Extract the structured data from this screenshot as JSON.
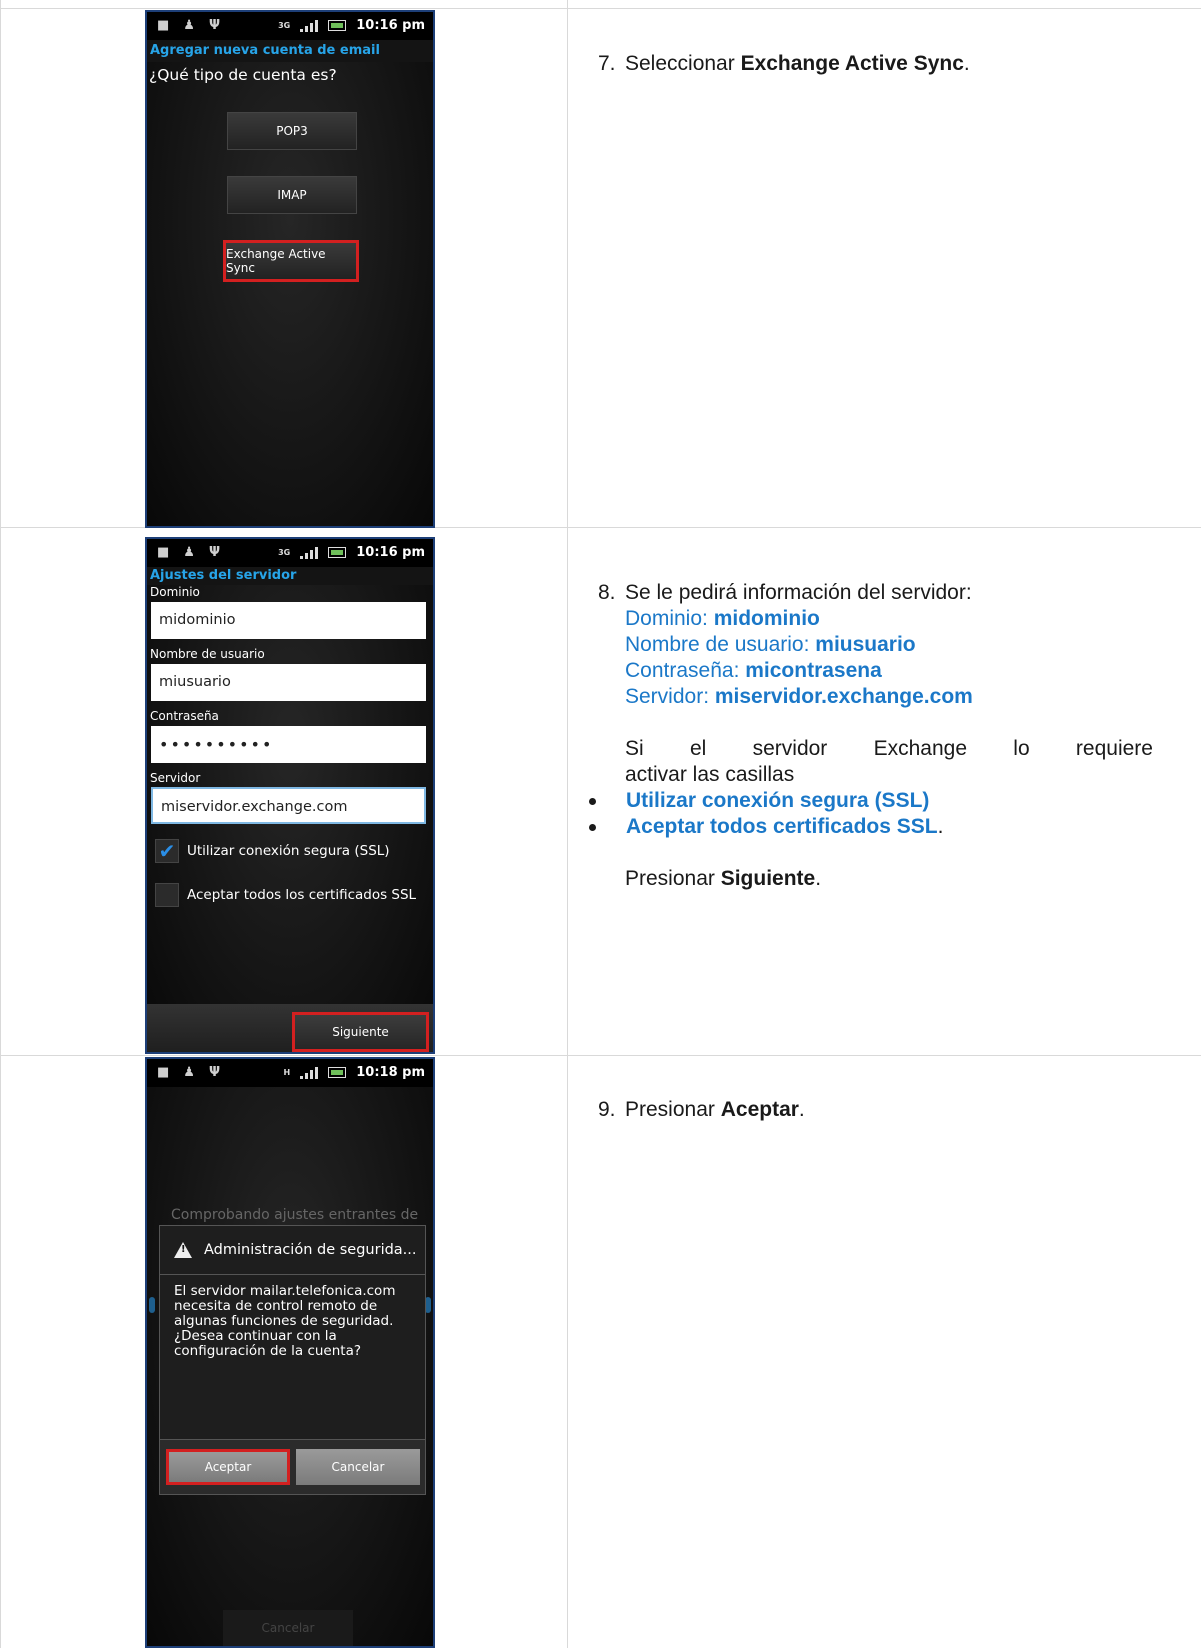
{
  "step7": {
    "number": "7.",
    "text": "Seleccionar ",
    "bold": "Exchange Active Sync",
    "end": "."
  },
  "screen1": {
    "time": "10:16 pm",
    "network": "3G",
    "title": "Agregar nueva cuenta de email",
    "question": "¿Qué tipo de cuenta es?",
    "options": [
      "POP3",
      "IMAP",
      "Exchange Active Sync"
    ]
  },
  "step8": {
    "number": "8.",
    "intro": "Se le pedirá información del servidor:",
    "fields": [
      {
        "label": "Dominio: ",
        "value": "midominio"
      },
      {
        "label": "Nombre de usuario: ",
        "value": "miusuario"
      },
      {
        "label": "Contraseña: ",
        "value": "micontrasena"
      },
      {
        "label": "Servidor: ",
        "value": "miservidor.exchange.com"
      }
    ],
    "note_line1": "Si el servidor Exchange lo requiere",
    "note_line2": "activar las casillas",
    "bullets": [
      "Utilizar conexión segura (SSL)",
      "Aceptar todos certificados SSL"
    ],
    "bullet_end": ".",
    "press": "Presionar ",
    "press_bold": "Siguiente",
    "press_end": "."
  },
  "screen2": {
    "time": "10:16 pm",
    "network": "3G",
    "title": "Ajustes del servidor",
    "domain_label": "Dominio",
    "domain_value": "midominio",
    "user_label": "Nombre de usuario",
    "user_value": "miusuario",
    "password_label": "Contraseña",
    "password_value": "••••••••••",
    "server_label": "Servidor",
    "server_value": "miservidor.exchange.com",
    "ssl_label": "Utilizar conexión segura (SSL)",
    "ssl_checked": true,
    "certs_label": "Aceptar todos los certificados SSL",
    "certs_checked": false,
    "next_label": "Siguiente"
  },
  "step9": {
    "number": "9.",
    "text": "Presionar ",
    "bold": "Aceptar",
    "end": "."
  },
  "screen3": {
    "time": "10:18 pm",
    "network": "H",
    "checking": "Comprobando ajustes entrantes de",
    "dialog_title": "Administración de segurida...",
    "dialog_body": "El servidor mailar.telefonica.com necesita de control remoto de algunas funciones de seguridad. ¿Desea continuar con la configuración de la cuenta?",
    "accept_label": "Aceptar",
    "cancel_label": "Cancelar",
    "bottom_cancel": "Cancelar"
  },
  "colors": {
    "accent_blue": "#1b78c8",
    "highlight_red": "#d32020",
    "android_title_blue": "#27a4e8"
  }
}
